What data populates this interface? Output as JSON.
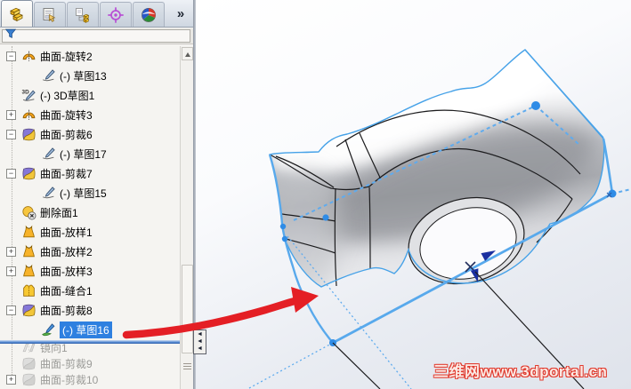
{
  "panel": {
    "tabs": [
      {
        "name": "featuremanager-tab",
        "icon": "feature-tree-icon",
        "active": true
      },
      {
        "name": "propertymanager-tab",
        "icon": "property-manager-icon",
        "active": false
      },
      {
        "name": "configurationmanager-tab",
        "icon": "configuration-icon",
        "active": false
      },
      {
        "name": "dimxpertmanager-tab",
        "icon": "dimxpert-icon",
        "active": false
      },
      {
        "name": "displaymanager-tab",
        "icon": "display-manager-icon",
        "active": false
      }
    ],
    "overflow_chevron": "»",
    "filter": {
      "icon": "filter-funnel-icon",
      "value": ""
    },
    "tree_items": [
      {
        "label": "曲面-旋转2",
        "icon": "revolve-surface-icon",
        "expand": "minus",
        "level": 0,
        "state": "normal"
      },
      {
        "label": "(-) 草图13",
        "icon": "sketch-icon",
        "expand": null,
        "level": 1,
        "state": "normal"
      },
      {
        "label": "(-) 3D草图1",
        "icon": "sketch3d-icon",
        "expand": null,
        "level": 0,
        "state": "normal"
      },
      {
        "label": "曲面-旋转3",
        "icon": "revolve-surface-icon",
        "expand": "plus",
        "level": 0,
        "state": "normal"
      },
      {
        "label": "曲面-剪裁6",
        "icon": "trim-surface-icon",
        "expand": "minus",
        "level": 0,
        "state": "normal"
      },
      {
        "label": "(-) 草图17",
        "icon": "sketch-icon",
        "expand": null,
        "level": 1,
        "state": "normal"
      },
      {
        "label": "曲面-剪裁7",
        "icon": "trim-surface-icon",
        "expand": "minus",
        "level": 0,
        "state": "normal"
      },
      {
        "label": "(-) 草图15",
        "icon": "sketch-icon",
        "expand": null,
        "level": 1,
        "state": "normal"
      },
      {
        "label": "删除面1",
        "icon": "delete-face-icon",
        "expand": null,
        "level": 0,
        "state": "normal"
      },
      {
        "label": "曲面-放样1",
        "icon": "loft-surface-icon",
        "expand": null,
        "level": 0,
        "state": "normal"
      },
      {
        "label": "曲面-放样2",
        "icon": "loft-surface-icon",
        "expand": "plus",
        "level": 0,
        "state": "normal"
      },
      {
        "label": "曲面-放样3",
        "icon": "loft-surface-icon",
        "expand": "plus",
        "level": 0,
        "state": "normal"
      },
      {
        "label": "曲面-缝合1",
        "icon": "knit-surface-icon",
        "expand": null,
        "level": 0,
        "state": "normal"
      },
      {
        "label": "曲面-剪裁8",
        "icon": "trim-surface-icon",
        "expand": "minus",
        "level": 0,
        "state": "normal"
      },
      {
        "label": "(-) 草图16",
        "icon": "sketch-edit-icon",
        "expand": null,
        "level": 1,
        "state": "selected"
      },
      {
        "label": "镜向1",
        "icon": "mirror-icon",
        "expand": null,
        "level": 0,
        "state": "disabled"
      },
      {
        "label": "曲面-剪裁9",
        "icon": "trim-gray-icon",
        "expand": null,
        "level": 0,
        "state": "disabled"
      },
      {
        "label": "曲面-剪裁10",
        "icon": "trim-gray-icon",
        "expand": "plus",
        "level": 0,
        "state": "disabled"
      }
    ]
  },
  "viewport": {
    "watermark": "三维网www.3dportal.cn"
  },
  "colors": {
    "selection_blue": "#2e80e0",
    "sketch_blue": "#4aa3e8",
    "sketch_blue_thick": "#58a9ec",
    "edge_black": "#1c1c1e",
    "annotation_red": "#e41f25",
    "rollback_blue": "#3a6db4",
    "navy_arrow": "#1a2fa0"
  }
}
